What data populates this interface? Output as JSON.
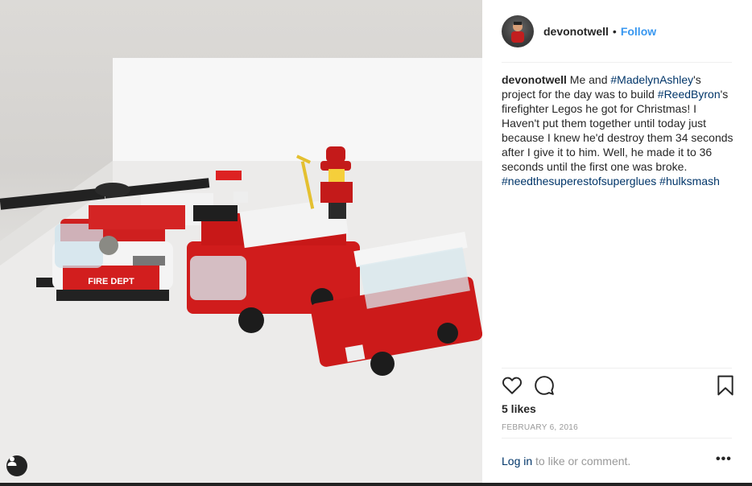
{
  "post": {
    "username": "devonotwell",
    "follow_separator": "•",
    "follow_label": "Follow",
    "caption": {
      "username": "devonotwell",
      "text_1": " Me and ",
      "tag_1": "#MadelynAshley",
      "text_2": "'s project for the day was to build ",
      "tag_2": "#ReedByron",
      "text_3": "'s firefighter Legos he got for Christmas! I Haven't put them together until today just because I knew he'd destroy them 34 seconds after I give it to him. Well, he made it to 36 seconds until the first one was broke. ",
      "tag_3": "#needthesuperestofsuperglues",
      "text_4": " ",
      "tag_4": "#hulksmash"
    },
    "likes": "5 likes",
    "date": "FEBRUARY 6, 2016",
    "login_link": "Log in",
    "login_text": " to like or comment.",
    "more_label": "•••"
  },
  "photo": {
    "helicopter_label": "FIRE DEPT"
  },
  "icons": {
    "like": "heart-icon",
    "comment": "comment-icon",
    "save": "bookmark-icon",
    "user_tag": "user-tag-icon"
  },
  "colors": {
    "link": "#003569",
    "follow": "#3897f0",
    "lego_red": "#c8191b",
    "muted": "#999999"
  }
}
